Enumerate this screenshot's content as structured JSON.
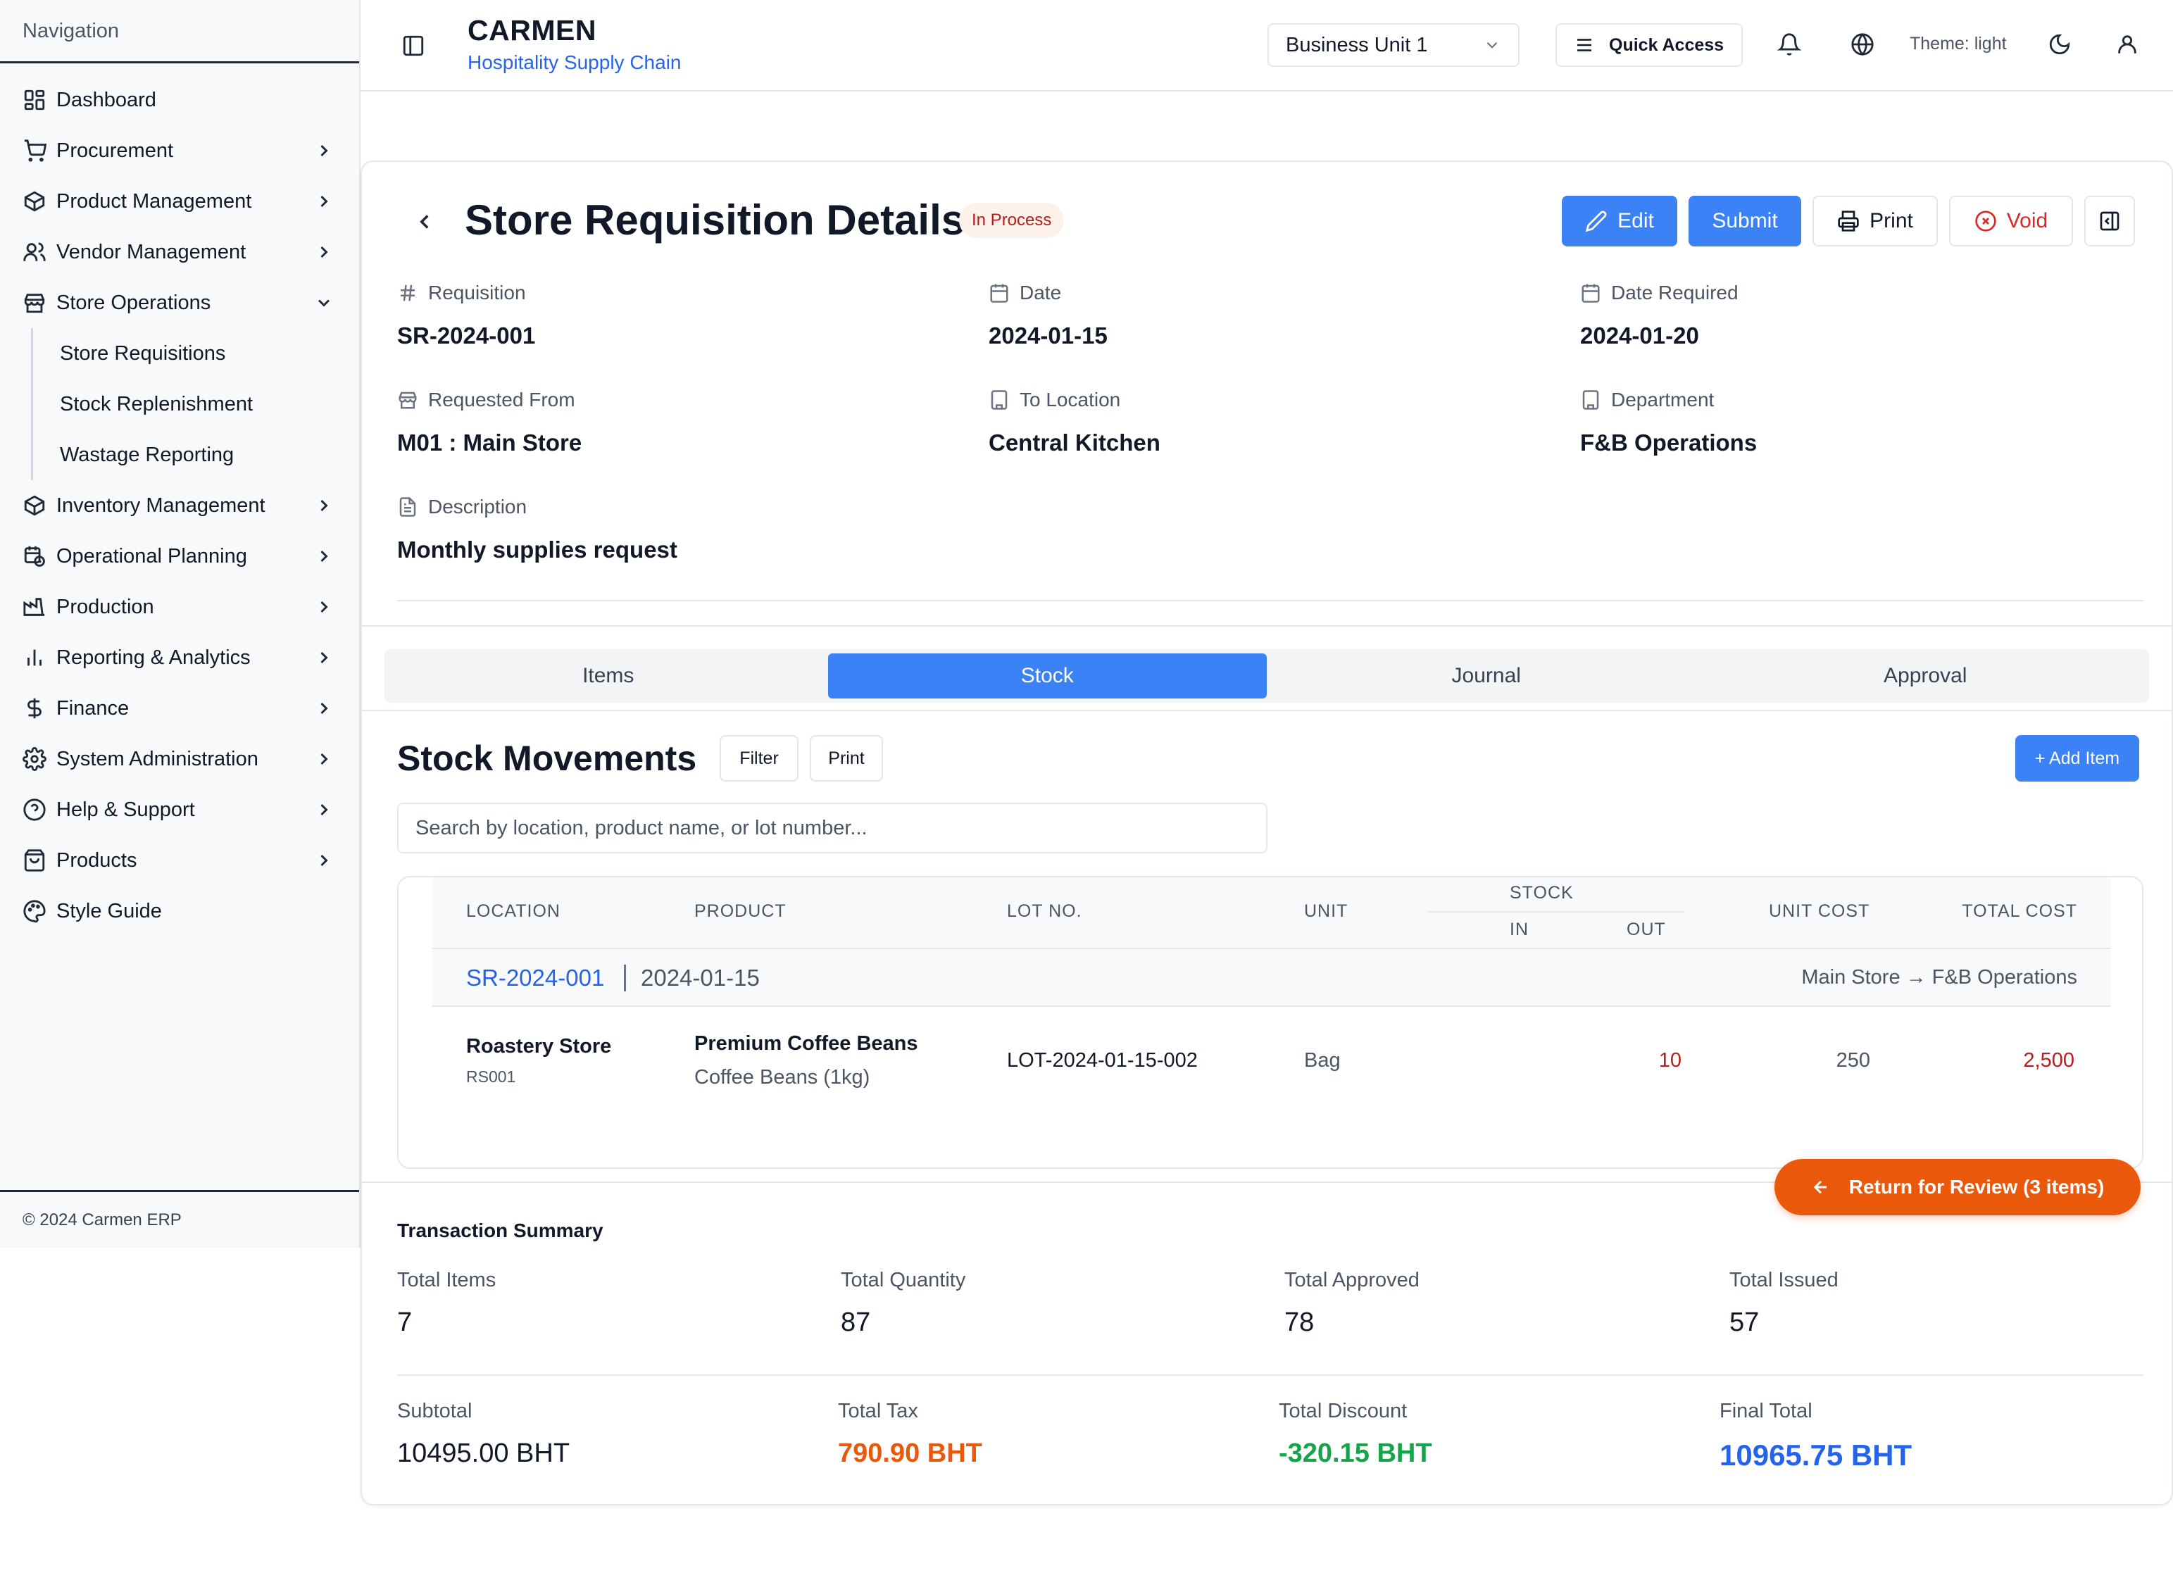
{
  "sidebar": {
    "title": "Navigation",
    "items": [
      {
        "label": "Dashboard"
      },
      {
        "label": "Procurement"
      },
      {
        "label": "Product Management"
      },
      {
        "label": "Vendor Management"
      },
      {
        "label": "Store Operations"
      },
      {
        "label": "Inventory Management"
      },
      {
        "label": "Operational Planning"
      },
      {
        "label": "Production"
      },
      {
        "label": "Reporting & Analytics"
      },
      {
        "label": "Finance"
      },
      {
        "label": "System Administration"
      },
      {
        "label": "Help & Support"
      },
      {
        "label": "Products"
      },
      {
        "label": "Style Guide"
      }
    ],
    "store_ops_sub": [
      {
        "label": "Store Requisitions"
      },
      {
        "label": "Stock Replenishment"
      },
      {
        "label": "Wastage Reporting"
      }
    ],
    "footer": "© 2024 Carmen ERP"
  },
  "header": {
    "brand": "CARMEN",
    "subtitle": "Hospitality Supply Chain",
    "business_unit": "Business Unit 1",
    "quick_access": "Quick Access",
    "theme_label": "Theme: light"
  },
  "page": {
    "title": "Store Requisition Details",
    "status": "In Process",
    "actions": {
      "edit": "Edit",
      "submit": "Submit",
      "print": "Print",
      "void": "Void"
    }
  },
  "fields": {
    "requisition": {
      "label": "Requisition",
      "value": "SR-2024-001"
    },
    "date": {
      "label": "Date",
      "value": "2024-01-15"
    },
    "date_required": {
      "label": "Date Required",
      "value": "2024-01-20"
    },
    "requested_from": {
      "label": "Requested From",
      "value": "M01 : Main Store"
    },
    "to_location": {
      "label": "To Location",
      "value": "Central Kitchen"
    },
    "department": {
      "label": "Department",
      "value": "F&B Operations"
    },
    "description": {
      "label": "Description",
      "value": "Monthly supplies request"
    }
  },
  "tabs": [
    {
      "label": "Items"
    },
    {
      "label": "Stock"
    },
    {
      "label": "Journal"
    },
    {
      "label": "Approval"
    }
  ],
  "stock_movements": {
    "title": "Stock Movements",
    "filter": "Filter",
    "print": "Print",
    "add_item": "+ Add Item",
    "search_placeholder": "Search by location, product name, or lot number...",
    "columns": {
      "location": "LOCATION",
      "product": "PRODUCT",
      "lot": "LOT NO.",
      "unit": "UNIT",
      "stock": "STOCK",
      "in": "IN",
      "out": "OUT",
      "unit_cost": "UNIT COST",
      "total_cost": "TOTAL COST"
    },
    "group": {
      "ref": "SR-2024-001",
      "date": "2024-01-15",
      "route": "Main Store → F&B Operations"
    },
    "rows": [
      {
        "location": "Roastery Store",
        "location_code": "RS001",
        "product": "Premium Coffee Beans",
        "product_detail": "Coffee Beans (1kg)",
        "lot": "LOT-2024-01-15-002",
        "unit": "Bag",
        "in": "",
        "out": "10",
        "unit_cost": "250",
        "total_cost": "2,500"
      }
    ]
  },
  "return_button": "Return for Review (3 items)",
  "summary": {
    "title": "Transaction Summary",
    "total_items": {
      "label": "Total Items",
      "value": "7"
    },
    "total_quantity": {
      "label": "Total Quantity",
      "value": "87"
    },
    "total_approved": {
      "label": "Total Approved",
      "value": "78"
    },
    "total_issued": {
      "label": "Total Issued",
      "value": "57"
    },
    "subtotal": {
      "label": "Subtotal",
      "value": "10495.00 BHT"
    },
    "total_tax": {
      "label": "Total Tax",
      "value": "790.90 BHT"
    },
    "total_discount": {
      "label": "Total Discount",
      "value": "-320.15 BHT"
    },
    "final_total": {
      "label": "Final Total",
      "value": "10965.75 BHT"
    }
  },
  "colors": {
    "accent": "#3b82f6",
    "link": "#2563eb",
    "danger": "#dc2626",
    "warning": "#ea580c",
    "success": "#16a34a"
  }
}
